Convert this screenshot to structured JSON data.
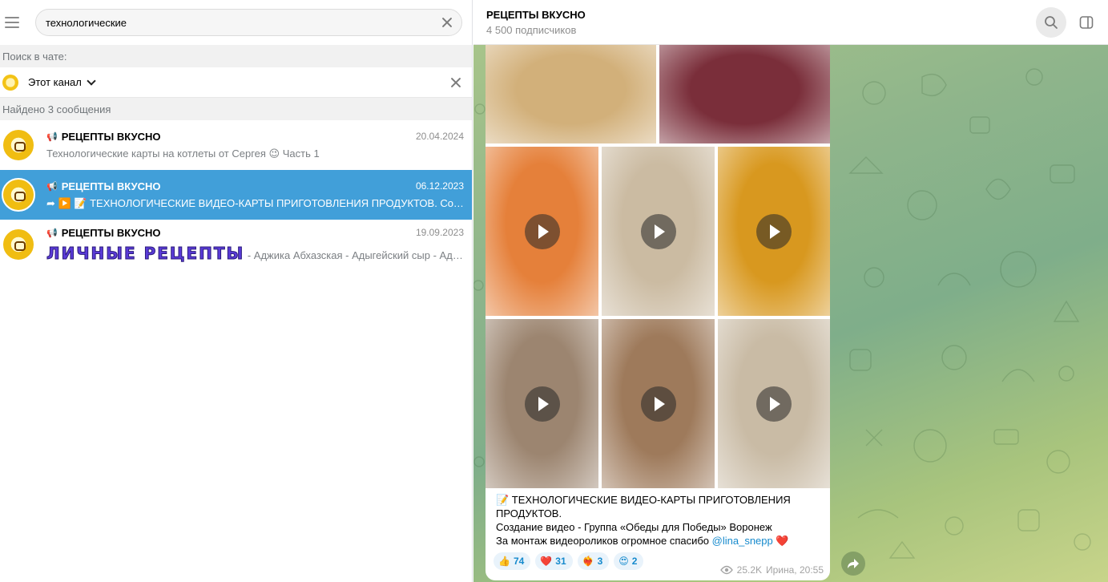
{
  "search": {
    "query": "технологические"
  },
  "filter": {
    "search_in_chat_label": "Поиск в чате:",
    "channel_label": "Этот канал",
    "found_label": "Найдено 3 сообщения"
  },
  "results": [
    {
      "title": "РЕЦЕПТЫ ВКУСНО",
      "date": "20.04.2024",
      "text": "Технологические карты на котлеты от Сергея 😉  Часть 1"
    },
    {
      "title": "РЕЦЕПТЫ ВКУСНО",
      "date": "06.12.2023",
      "text": "➦ ▶️ 📝 ТЕХНОЛОГИЧЕСКИЕ ВИДЕО-КАРТЫ ПРИГОТОВЛЕНИЯ ПРОДУКТОВ.  Создание видео - Группа «Обеды для Победы» Воронеж"
    },
    {
      "title": "РЕЦЕПТЫ ВКУСНО",
      "date": "19.09.2023",
      "fancy": "ЛИЧНЫЕ РЕЦЕПТЫ",
      "text": " - Аджика Абхазская - Адыгейский сыр  - Аджика зеленая"
    }
  ],
  "chat": {
    "title": "РЕЦЕПТЫ ВКУСНО",
    "subscribers": "4 500 подписчиков"
  },
  "message": {
    "caption_line1": "📝 ТЕХНОЛОГИЧЕСКИЕ ВИДЕО-КАРТЫ ПРИГОТОВЛЕНИЯ ПРОДУКТОВ.",
    "caption_line2": "Создание видео - Группа «Обеды для Победы» Воронеж",
    "caption_line3": "За монтаж видеороликов огромное спасибо ",
    "mention": "@lina_snepp",
    "heart": "❤️",
    "reactions": [
      {
        "emoji": "👍",
        "count": "74"
      },
      {
        "emoji": "❤️",
        "count": "31"
      },
      {
        "emoji": "❤️‍🔥",
        "count": "3"
      },
      {
        "emoji": "😍",
        "count": "2"
      }
    ],
    "views": "25.2K",
    "author_time": "Ирина, 20:55"
  },
  "colors": {
    "accent": "#419fd9",
    "link": "#168acd",
    "tiles": [
      "#d2b07a",
      "#7a2e3a",
      "#e5803a",
      "#cbbba2",
      "#d8981f",
      "#9c8570",
      "#9e7a5b",
      "#c9bba5"
    ]
  },
  "icons": {
    "menu": "hamburger-icon",
    "search": "search-icon",
    "sidebar": "sidebar-toggle-icon",
    "views": "eye-icon",
    "share": "share-arrow-icon",
    "play": "play-icon"
  }
}
